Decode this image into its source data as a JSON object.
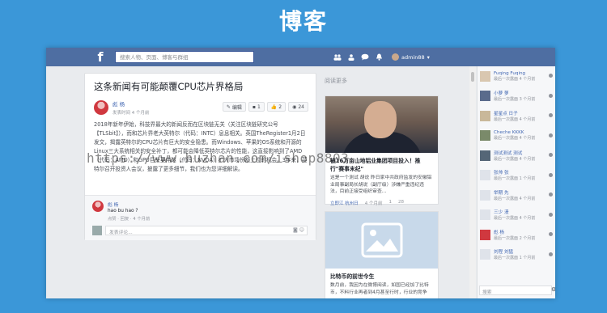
{
  "banner_title": "博客",
  "topbar": {
    "logo": "f",
    "search_placeholder": "搜索人物、页面、博客与群组",
    "username": "admin88"
  },
  "post": {
    "title": "这条新闻有可能颠覆CPU芯片界格局",
    "author": "彪 杨",
    "time": "发表时间 4 个月前",
    "edit_label": "编辑",
    "comment_count": "1",
    "like_count": "2",
    "view_count": "24",
    "body": "2018年新年伊始，科技界最大的新闻反而在区块链无关（关注区块链研究公号【TLSbit】），而和芯片界老大英特尔（代码：INTC）息息相关。英国TheRegister1月2日发文，揭露英特尔的CPU芯片有巨大的安全隐患。而Windows、苹果的OS系统和开源的Linux三大系统相关的安全补丁，都可能会降低英特尔芯片的性能，这直接影响到了AMD（代码：AMD）和GPU巨头英伟达（代码：NVDA）扩大市场份额上位的机会。3年来，英特尔召开投资人会议，披露了更多细节，我们也为您详细解读。",
    "comment": {
      "author": "彪 杨",
      "text": "hao bu hao ?",
      "actions": "点赞 · 回复 · 4 个月前"
    },
    "comment_placeholder": "发表评论..."
  },
  "readmore": {
    "heading": "阅读更多",
    "cards": [
      {
        "title": "被16万亩山地铝业集团项目投入！推行\"赛事末纪\"",
        "desc": "这是一个测试 胡说 昨日家中共政府监发的安徽铝业局事副局长胡说（副厅级）涉嫌严重违纪违法，目前正接受组织审查...",
        "location": "立即江  杭州日",
        "time": "4 个月前",
        "count1": "1",
        "count2": "28"
      },
      {
        "title": "比特币的前世今生",
        "desc": "数月前，我因为在微博阅读，如国已经加了比特币，不料行业再者到4月甚至行时，行业的竞争",
        "location": "",
        "time": "",
        "count1": "",
        "count2": ""
      }
    ]
  },
  "sidebar": {
    "friends": [
      {
        "name": "Fuqing Fuqing",
        "time": "最后一次露面 4 个月前",
        "color": "#d9c7b0"
      },
      {
        "name": "小萝 萝",
        "time": "最后一次露面 3 个月前",
        "color": "#5a6b8c"
      },
      {
        "name": "星星点 日子",
        "time": "最后一次露面 4 个月前",
        "color": "#c9b89a"
      },
      {
        "name": "Cheche KKKK",
        "time": "最后一次露面 4 个月前",
        "color": "#7a8a6a"
      },
      {
        "name": "测试测试 测试",
        "time": "最后一次露面 4 个月前",
        "color": "#556677"
      },
      {
        "name": "张帅 张",
        "time": "最后一次露面 1 个月前",
        "color": "#dfe3ea"
      },
      {
        "name": "举期 先",
        "time": "最后一次露面 4 个月前",
        "color": "#dfe3ea"
      },
      {
        "name": "三少 漫",
        "time": "最后一次露面 4 个月前",
        "color": "#dfe3ea"
      },
      {
        "name": "彪 杨",
        "time": "最后一次露面 2 个月前",
        "color": "#d0383f"
      },
      {
        "name": "刘程 刘猛",
        "time": "最后一次露面 1 个月前",
        "color": "#dfe3ea"
      }
    ],
    "search_placeholder": "搜索"
  },
  "watermark": "https://www.huzhan.com/ishop8803"
}
